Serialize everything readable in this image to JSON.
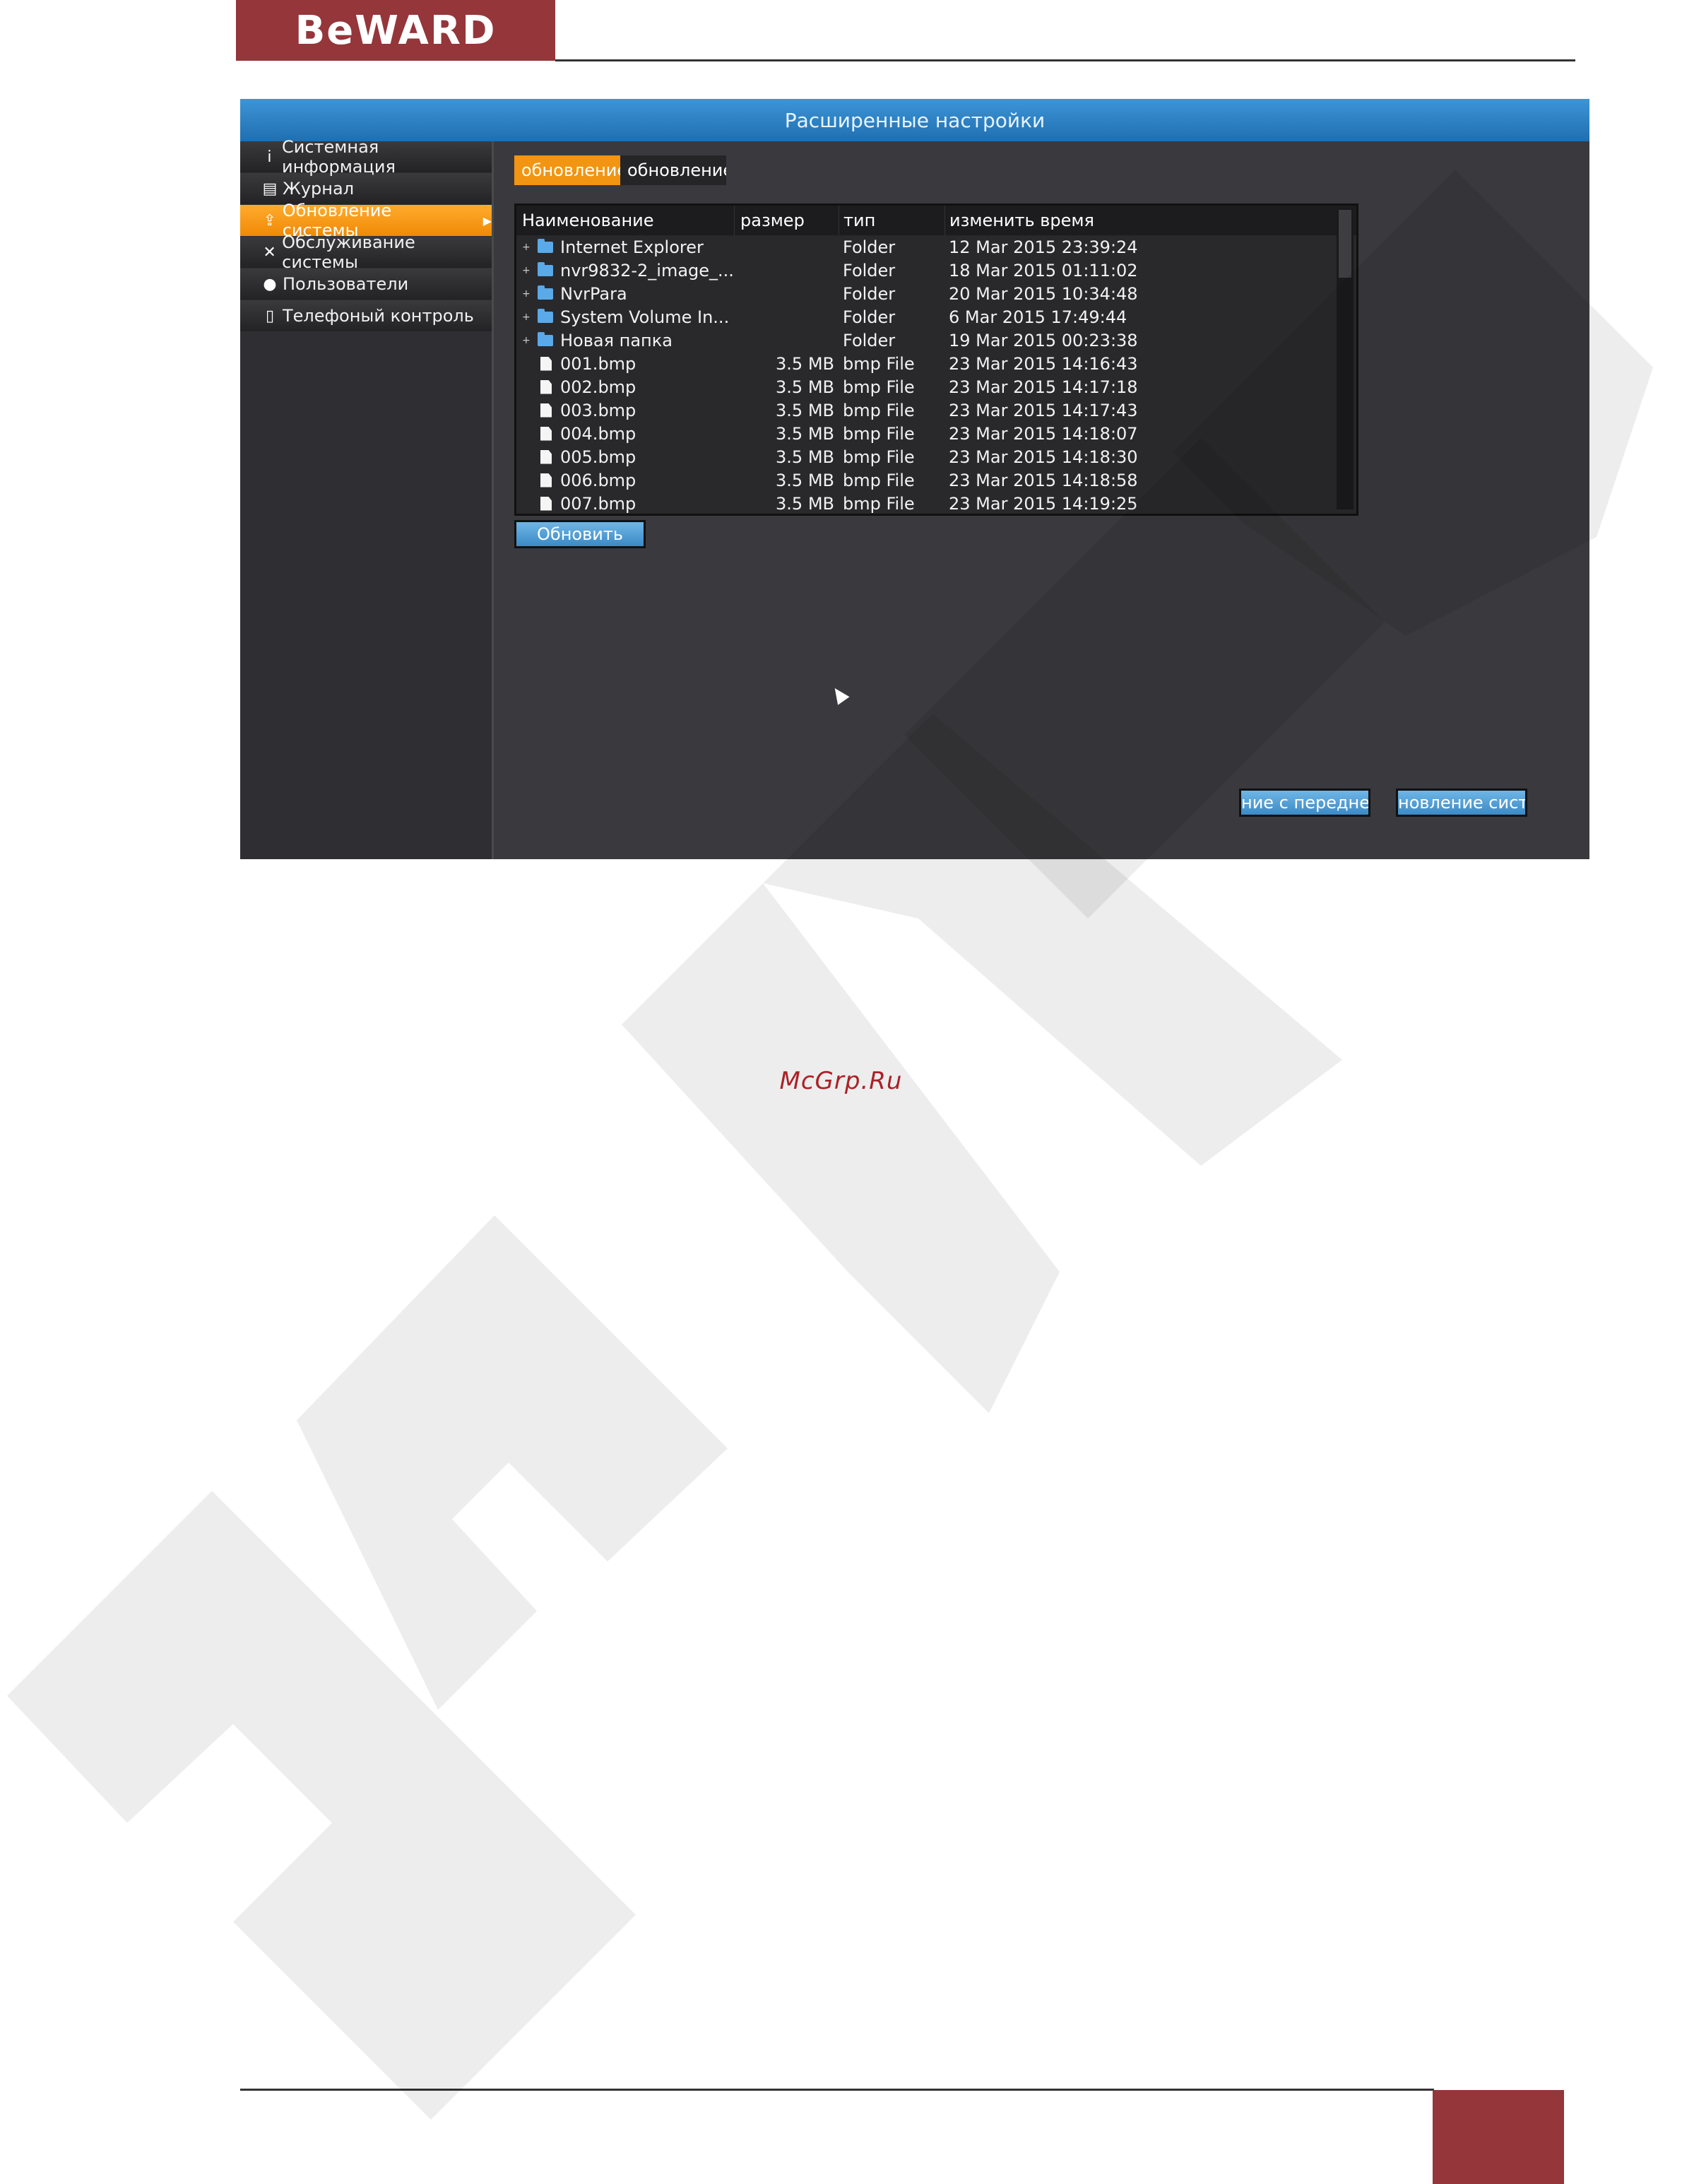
{
  "brand": {
    "logo_text": "BeWARD",
    "accent": "#94363a"
  },
  "app": {
    "title": "Расширенные настройки",
    "sidebar": {
      "items": [
        {
          "label": "Системная информация",
          "icon": "info-icon",
          "active": false
        },
        {
          "label": "Журнал",
          "icon": "document-icon",
          "active": false
        },
        {
          "label": "Обновление системы",
          "icon": "upload-icon",
          "active": true
        },
        {
          "label": "Обслуживание системы",
          "icon": "tools-icon",
          "active": false
        },
        {
          "label": "Пользователи",
          "icon": "user-icon",
          "active": false
        },
        {
          "label": "Телефоный контроль",
          "icon": "phone-icon",
          "active": false
        }
      ]
    },
    "tabs": [
      {
        "label": "обновление с",
        "active": true
      },
      {
        "label": "обновление ч",
        "active": false
      }
    ],
    "table": {
      "headers": {
        "name": "Наименование",
        "size": "размер",
        "type": "тип",
        "time": "изменить время"
      },
      "rows": [
        {
          "kind": "folder",
          "name": "Internet Explorer",
          "size": "",
          "type": "Folder",
          "time": "12 Mar 2015 23:39:24"
        },
        {
          "kind": "folder",
          "name": "nvr9832-2_image_...",
          "size": "",
          "type": "Folder",
          "time": "18 Mar 2015 01:11:02"
        },
        {
          "kind": "folder",
          "name": "NvrPara",
          "size": "",
          "type": "Folder",
          "time": "20 Mar 2015 10:34:48"
        },
        {
          "kind": "folder",
          "name": "System Volume In...",
          "size": "",
          "type": "Folder",
          "time": "6 Mar 2015 17:49:44"
        },
        {
          "kind": "folder",
          "name": "Новая папка",
          "size": "",
          "type": "Folder",
          "time": "19 Mar 2015 00:23:38"
        },
        {
          "kind": "file",
          "name": "001.bmp",
          "size": "3.5 MB",
          "type": "bmp File",
          "time": "23 Mar 2015 14:16:43"
        },
        {
          "kind": "file",
          "name": "002.bmp",
          "size": "3.5 MB",
          "type": "bmp File",
          "time": "23 Mar 2015 14:17:18"
        },
        {
          "kind": "file",
          "name": "003.bmp",
          "size": "3.5 MB",
          "type": "bmp File",
          "time": "23 Mar 2015 14:17:43"
        },
        {
          "kind": "file",
          "name": "004.bmp",
          "size": "3.5 MB",
          "type": "bmp File",
          "time": "23 Mar 2015 14:18:07"
        },
        {
          "kind": "file",
          "name": "005.bmp",
          "size": "3.5 MB",
          "type": "bmp File",
          "time": "23 Mar 2015 14:18:30"
        },
        {
          "kind": "file",
          "name": "006.bmp",
          "size": "3.5 MB",
          "type": "bmp File",
          "time": "23 Mar 2015 14:18:58"
        },
        {
          "kind": "file",
          "name": "007.bmp",
          "size": "3.5 MB",
          "type": "bmp File",
          "time": "23 Mar 2015 14:19:25"
        }
      ]
    },
    "refresh_label": "Обновить",
    "bottom_buttons": [
      {
        "label": "ние с передней"
      },
      {
        "label": "новление систе"
      }
    ]
  },
  "site_link": "McGrp.Ru"
}
